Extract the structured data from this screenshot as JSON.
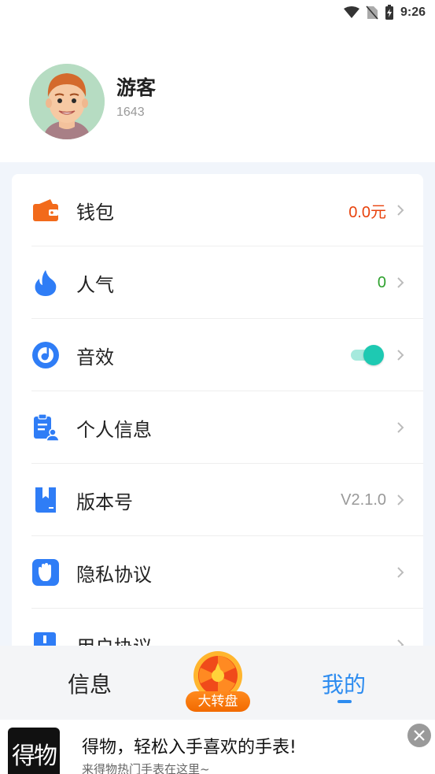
{
  "status_bar": {
    "time": "9:26",
    "icons": [
      "wifi-icon",
      "no-sim-icon",
      "battery-charging-icon"
    ]
  },
  "profile": {
    "name": "游客",
    "id": "1643",
    "avatar": "cartoon-man-avatar"
  },
  "menu": [
    {
      "label": "钱包",
      "value": "0.0元",
      "value_color": "#e8420c",
      "icon": "wallet-icon"
    },
    {
      "label": "人气",
      "value": "0",
      "value_color": "#2ea12e",
      "icon": "flame-icon"
    },
    {
      "label": "音效",
      "value": "",
      "toggle_on": true,
      "icon": "music-disc-icon"
    },
    {
      "label": "个人信息",
      "value": "",
      "icon": "profile-clipboard-icon"
    },
    {
      "label": "版本号",
      "value": "V2.1.0",
      "value_color": "#999999",
      "icon": "bookmark-book-icon"
    },
    {
      "label": "隐私协议",
      "value": "",
      "icon": "hand-icon"
    },
    {
      "label": "用户协议",
      "value": "",
      "icon": "document-icon"
    }
  ],
  "bottom_nav": {
    "info_label": "信息",
    "wheel_label": "大转盘",
    "mine_label": "我的",
    "active": "我的",
    "active_color": "#2d8cf0"
  },
  "ad": {
    "logo_text": "得物",
    "title": "得物，轻松入手喜欢的手表!",
    "subtitle": "来得物热门手表在这里~"
  }
}
